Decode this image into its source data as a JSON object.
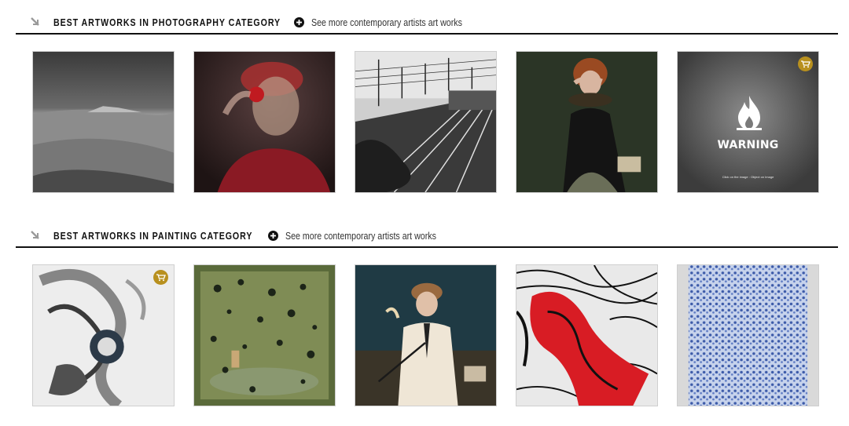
{
  "sections": [
    {
      "title": "BEST ARTWORKS IN PHOTOGRAPHY CATEGORY",
      "see_more": "See more contemporary artists art works",
      "items": [
        {
          "subject": "minimalist black and white snowy landscape"
        },
        {
          "subject": "woman in red holding a rose behind misty glass"
        },
        {
          "subject": "black and white railway tracks and power lines"
        },
        {
          "subject": "red-haired woman in lace ruff collar covering eyes"
        },
        {
          "subject": "content warning placeholder",
          "cart": true,
          "warning_label": "WARNING",
          "warning_sub": "Click on the image : Object on Image"
        }
      ]
    },
    {
      "title": "BEST ARTWORKS IN PAINTING CATEGORY",
      "see_more": "See more contemporary artists art works",
      "items": [
        {
          "subject": "abstract grey and white swirling forms",
          "cart": true
        },
        {
          "subject": "green textured painting with dark dots and deer"
        },
        {
          "subject": "woman in cream sweater with riding crop seated"
        },
        {
          "subject": "red and black abstract pattern"
        },
        {
          "subject": "blue and white mosaic pattern"
        }
      ]
    }
  ],
  "colors": {
    "accent_cart": "#b8901e",
    "rule": "#111111",
    "arrow": "#9a9a9a"
  }
}
